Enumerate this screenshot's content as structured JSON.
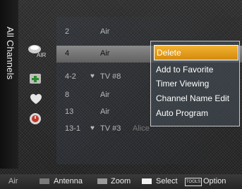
{
  "sidebar": {
    "title": "All Channels"
  },
  "icons": [
    {
      "name": "air-antenna-icon",
      "sub": "AIR"
    },
    {
      "name": "add-channel-icon",
      "sub": ""
    },
    {
      "name": "favorite-heart-icon",
      "sub": ""
    },
    {
      "name": "clock-timer-icon",
      "sub": ""
    }
  ],
  "channels": [
    {
      "num": "2",
      "fav": "",
      "type": "Air",
      "name": ""
    },
    {
      "num": "4",
      "fav": "",
      "type": "Air",
      "name": ""
    },
    {
      "num": "4-2",
      "fav": "♥",
      "type": "TV #8",
      "name": ""
    },
    {
      "num": "8",
      "fav": "",
      "type": "Air",
      "name": ""
    },
    {
      "num": "13",
      "fav": "",
      "type": "Air",
      "name": ""
    },
    {
      "num": "13-1",
      "fav": "♥",
      "type": "TV #3",
      "name": "Alice"
    }
  ],
  "menu": {
    "items": [
      "Delete",
      "Add to Favorite",
      "Timer Viewing",
      "Channel Name Edit",
      "Auto Program"
    ],
    "highlight_color": "#e8a020"
  },
  "footer": {
    "air": "Air",
    "antenna": "Antenna",
    "zoom": "Zoom",
    "select": "Select",
    "tools_key": "TOOLS",
    "option": "Option",
    "colors": {
      "antenna": "#7a7a7a",
      "zoom": "#9a9a9a",
      "select": "#f2f2f2"
    }
  }
}
